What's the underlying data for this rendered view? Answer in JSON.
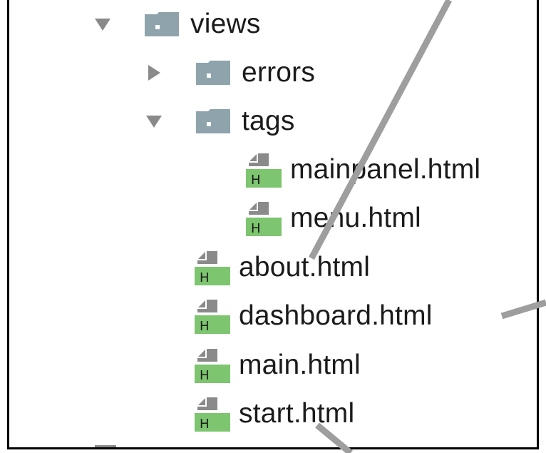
{
  "tree": {
    "views": {
      "label": "views",
      "state": "expanded",
      "icon": "folder-icon"
    },
    "errors": {
      "label": "errors",
      "state": "collapsed",
      "icon": "folder-icon"
    },
    "tags": {
      "label": "tags",
      "state": "expanded",
      "icon": "folder-icon"
    },
    "files": [
      {
        "label": "mainpanel.html",
        "icon": "html-file-icon"
      },
      {
        "label": "menu.html",
        "icon": "html-file-icon"
      },
      {
        "label": "about.html",
        "icon": "html-file-icon"
      },
      {
        "label": "dashboard.html",
        "icon": "html-file-icon"
      },
      {
        "label": "main.html",
        "icon": "html-file-icon"
      },
      {
        "label": "start.html",
        "icon": "html-file-icon"
      }
    ],
    "file_badge": "H"
  },
  "colors": {
    "folder": "#8fa3ad",
    "arrow": "#8a8a8a",
    "file_badge": "#7dc56f",
    "file_page": "#8a8a8a",
    "pointer_line": "#9e9e9e"
  }
}
